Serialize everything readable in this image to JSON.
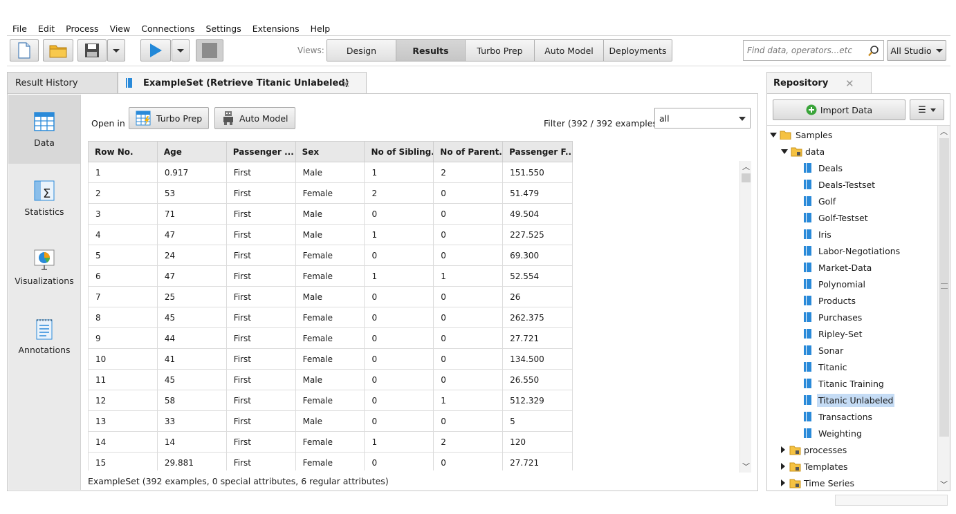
{
  "menu": [
    {
      "label": "File"
    },
    {
      "label": "Edit"
    },
    {
      "label": "Process"
    },
    {
      "label": "View"
    },
    {
      "label": "Connections"
    },
    {
      "label": "Settings"
    },
    {
      "label": "Extensions"
    },
    {
      "label": "Help"
    }
  ],
  "toolbar": {
    "views_label": "Views:",
    "views": [
      "Design",
      "Results",
      "Turbo Prep",
      "Auto Model",
      "Deployments"
    ],
    "active_view": "Results",
    "search_placeholder": "Find data, operators...etc",
    "studio_label": "All Studio"
  },
  "tabs": {
    "history": "Result History",
    "active": "ExampleSet (Retrieve Titanic Unlabeled)"
  },
  "leftnav": [
    {
      "label": "Data",
      "icon": "table-icon"
    },
    {
      "label": "Statistics",
      "icon": "statistics-icon"
    },
    {
      "label": "Visualizations",
      "icon": "chart-icon"
    },
    {
      "label": "Annotations",
      "icon": "annotations-icon"
    }
  ],
  "results": {
    "open_in": "Open in",
    "turbo_prep_btn": "Turbo Prep",
    "auto_model_btn": "Auto Model",
    "filter_label": "Filter (392 / 392 examples):",
    "filter_value": "all",
    "columns": [
      "Row No.",
      "Age",
      "Passenger ...",
      "Sex",
      "No of Sibling...",
      "No of Parent...",
      "Passenger F..."
    ],
    "rows": [
      [
        "1",
        "0.917",
        "First",
        "Male",
        "1",
        "2",
        "151.550"
      ],
      [
        "2",
        "53",
        "First",
        "Female",
        "2",
        "0",
        "51.479"
      ],
      [
        "3",
        "71",
        "First",
        "Male",
        "0",
        "0",
        "49.504"
      ],
      [
        "4",
        "47",
        "First",
        "Male",
        "1",
        "0",
        "227.525"
      ],
      [
        "5",
        "24",
        "First",
        "Female",
        "0",
        "0",
        "69.300"
      ],
      [
        "6",
        "47",
        "First",
        "Female",
        "1",
        "1",
        "52.554"
      ],
      [
        "7",
        "25",
        "First",
        "Male",
        "0",
        "0",
        "26"
      ],
      [
        "8",
        "45",
        "First",
        "Female",
        "0",
        "0",
        "262.375"
      ],
      [
        "9",
        "44",
        "First",
        "Female",
        "0",
        "0",
        "27.721"
      ],
      [
        "10",
        "41",
        "First",
        "Female",
        "0",
        "0",
        "134.500"
      ],
      [
        "11",
        "45",
        "First",
        "Male",
        "0",
        "0",
        "26.550"
      ],
      [
        "12",
        "58",
        "First",
        "Female",
        "0",
        "1",
        "512.329"
      ],
      [
        "13",
        "33",
        "First",
        "Male",
        "0",
        "0",
        "5"
      ],
      [
        "14",
        "14",
        "First",
        "Female",
        "1",
        "2",
        "120"
      ],
      [
        "15",
        "29.881",
        "First",
        "Female",
        "0",
        "0",
        "27.721"
      ]
    ],
    "summary": "ExampleSet (392 examples, 0 special attributes, 6 regular attributes)"
  },
  "repository": {
    "title": "Repository",
    "import_label": "Import Data",
    "menu_label": "☰",
    "tree": {
      "samples": "Samples",
      "data_folder": "data",
      "items": [
        "Deals",
        "Deals-Testset",
        "Golf",
        "Golf-Testset",
        "Iris",
        "Labor-Negotiations",
        "Market-Data",
        "Polynomial",
        "Products",
        "Purchases",
        "Ripley-Set",
        "Sonar",
        "Titanic",
        "Titanic Training",
        "Titanic Unlabeled",
        "Transactions",
        "Weighting"
      ],
      "selected": "Titanic Unlabeled",
      "folders": [
        "processes",
        "Templates",
        "Time Series"
      ]
    }
  },
  "colors": {
    "accent": "#1e88d8",
    "selection": "#c5dcf5",
    "folder": "#f5c242"
  }
}
